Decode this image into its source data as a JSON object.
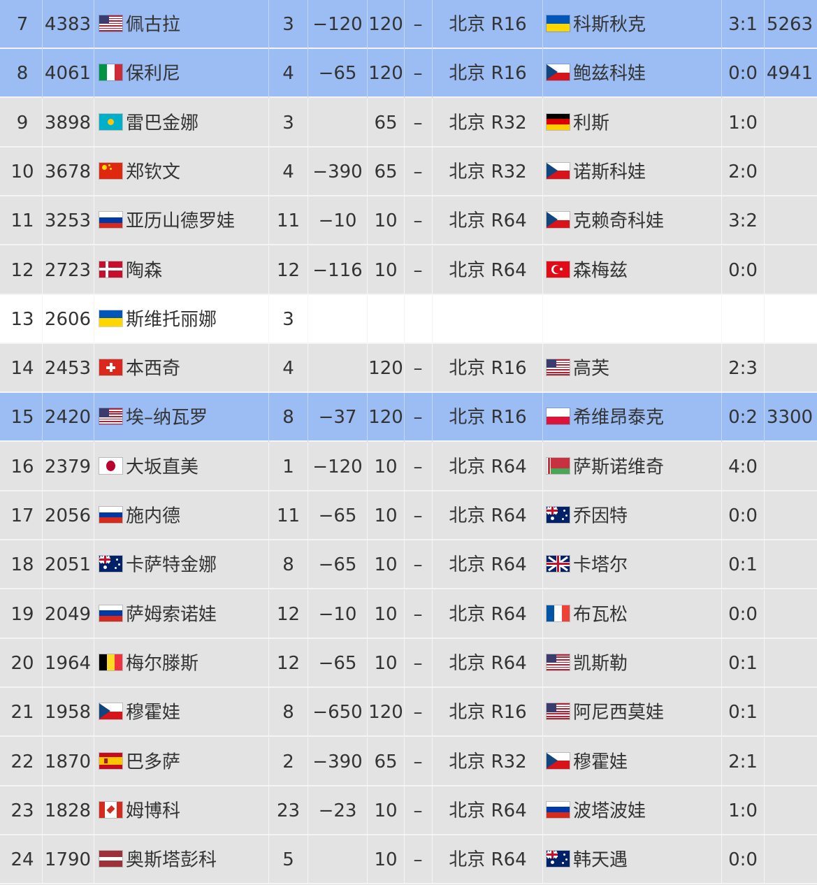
{
  "rows": [
    {
      "rank": "7",
      "points": "4383",
      "flag": "usa-flag-icon",
      "player": "佩古拉",
      "seed": "3",
      "diff": "−120",
      "defend": "120",
      "dash": "–",
      "event": "北京 R16",
      "opp_flag": "ukraine-flag-icon",
      "opponent": "科斯秋克",
      "score": "3:1",
      "projected": "5263",
      "highlight": "blue"
    },
    {
      "rank": "8",
      "points": "4061",
      "flag": "italy-flag-icon",
      "player": "保利尼",
      "seed": "4",
      "diff": "−65",
      "defend": "120",
      "dash": "–",
      "event": "北京 R16",
      "opp_flag": "czech-flag-icon",
      "opponent": "鲍兹科娃",
      "score": "0:0",
      "projected": "4941",
      "highlight": "blue"
    },
    {
      "rank": "9",
      "points": "3898",
      "flag": "kazakhstan-flag-icon",
      "player": "雷巴金娜",
      "seed": "3",
      "diff": "",
      "defend": "65",
      "dash": "–",
      "event": "北京 R32",
      "opp_flag": "germany-flag-icon",
      "opponent": "利斯",
      "score": "1:0",
      "projected": "",
      "highlight": "grey"
    },
    {
      "rank": "10",
      "points": "3678",
      "flag": "china-flag-icon",
      "player": "郑钦文",
      "seed": "4",
      "diff": "−390",
      "defend": "65",
      "dash": "–",
      "event": "北京 R32",
      "opp_flag": "czech-flag-icon",
      "opponent": "诺斯科娃",
      "score": "2:0",
      "projected": "",
      "highlight": "grey"
    },
    {
      "rank": "11",
      "points": "3253",
      "flag": "russia-flag-icon",
      "player": "亚历山德罗娃",
      "seed": "11",
      "diff": "−10",
      "defend": "10",
      "dash": "–",
      "event": "北京 R64",
      "opp_flag": "czech-flag-icon",
      "opponent": "克赖奇科娃",
      "score": "3:2",
      "projected": "",
      "highlight": "grey"
    },
    {
      "rank": "12",
      "points": "2723",
      "flag": "denmark-flag-icon",
      "player": "陶森",
      "seed": "12",
      "diff": "−116",
      "defend": "10",
      "dash": "–",
      "event": "北京 R64",
      "opp_flag": "turkey-flag-icon",
      "opponent": "森梅兹",
      "score": "0:0",
      "projected": "",
      "highlight": "grey"
    },
    {
      "rank": "13",
      "points": "2606",
      "flag": "ukraine-flag-icon",
      "player": "斯维托丽娜",
      "seed": "3",
      "diff": "",
      "defend": "",
      "dash": "",
      "event": "",
      "opp_flag": "",
      "opponent": "",
      "score": "",
      "projected": "",
      "highlight": "white"
    },
    {
      "rank": "14",
      "points": "2453",
      "flag": "switzerland-flag-icon",
      "player": "本西奇",
      "seed": "4",
      "diff": "",
      "defend": "120",
      "dash": "–",
      "event": "北京 R16",
      "opp_flag": "usa-flag-icon",
      "opponent": "高芙",
      "score": "2:3",
      "projected": "",
      "highlight": "grey"
    },
    {
      "rank": "15",
      "points": "2420",
      "flag": "usa-flag-icon",
      "player": "埃–纳瓦罗",
      "seed": "8",
      "diff": "−37",
      "defend": "120",
      "dash": "–",
      "event": "北京 R16",
      "opp_flag": "poland-flag-icon",
      "opponent": "希维昂泰克",
      "score": "0:2",
      "projected": "3300",
      "highlight": "blue"
    },
    {
      "rank": "16",
      "points": "2379",
      "flag": "japan-flag-icon",
      "player": "大坂直美",
      "seed": "1",
      "diff": "−120",
      "defend": "10",
      "dash": "–",
      "event": "北京 R64",
      "opp_flag": "belarus-flag-icon",
      "opponent": "萨斯诺维奇",
      "score": "4:0",
      "projected": "",
      "highlight": "grey"
    },
    {
      "rank": "17",
      "points": "2056",
      "flag": "russia-flag-icon",
      "player": "施内德",
      "seed": "11",
      "diff": "−65",
      "defend": "10",
      "dash": "–",
      "event": "北京 R64",
      "opp_flag": "australia-flag-icon",
      "opponent": "乔因特",
      "score": "0:0",
      "projected": "",
      "highlight": "grey"
    },
    {
      "rank": "18",
      "points": "2051",
      "flag": "australia-flag-icon",
      "player": "卡萨特金娜",
      "seed": "8",
      "diff": "−65",
      "defend": "10",
      "dash": "–",
      "event": "北京 R64",
      "opp_flag": "uk-flag-icon",
      "opponent": "卡塔尔",
      "score": "0:1",
      "projected": "",
      "highlight": "grey"
    },
    {
      "rank": "19",
      "points": "2049",
      "flag": "russia-flag-icon",
      "player": "萨姆索诺娃",
      "seed": "12",
      "diff": "−10",
      "defend": "10",
      "dash": "–",
      "event": "北京 R64",
      "opp_flag": "france-flag-icon",
      "opponent": "布瓦松",
      "score": "0:0",
      "projected": "",
      "highlight": "grey"
    },
    {
      "rank": "20",
      "points": "1964",
      "flag": "belgium-flag-icon",
      "player": "梅尔滕斯",
      "seed": "12",
      "diff": "−65",
      "defend": "10",
      "dash": "–",
      "event": "北京 R64",
      "opp_flag": "usa-flag-icon",
      "opponent": "凯斯勒",
      "score": "0:1",
      "projected": "",
      "highlight": "grey"
    },
    {
      "rank": "21",
      "points": "1958",
      "flag": "czech-flag-icon",
      "player": "穆霍娃",
      "seed": "8",
      "diff": "−650",
      "defend": "120",
      "dash": "–",
      "event": "北京 R16",
      "opp_flag": "usa-flag-icon",
      "opponent": "阿尼西莫娃",
      "score": "0:1",
      "projected": "",
      "highlight": "grey"
    },
    {
      "rank": "22",
      "points": "1870",
      "flag": "spain-flag-icon",
      "player": "巴多萨",
      "seed": "2",
      "diff": "−390",
      "defend": "65",
      "dash": "–",
      "event": "北京 R32",
      "opp_flag": "czech-flag-icon",
      "opponent": "穆霍娃",
      "score": "2:1",
      "projected": "",
      "highlight": "grey"
    },
    {
      "rank": "23",
      "points": "1828",
      "flag": "canada-flag-icon",
      "player": "姆博科",
      "seed": "23",
      "diff": "−23",
      "defend": "10",
      "dash": "–",
      "event": "北京 R64",
      "opp_flag": "russia-flag-icon",
      "opponent": "波塔波娃",
      "score": "1:0",
      "projected": "",
      "highlight": "grey"
    },
    {
      "rank": "24",
      "points": "1790",
      "flag": "latvia-flag-icon",
      "player": "奥斯塔彭科",
      "seed": "5",
      "diff": "",
      "defend": "10",
      "dash": "–",
      "event": "北京 R64",
      "opp_flag": "australia-flag-icon",
      "opponent": "韩天遇",
      "score": "0:0",
      "projected": "",
      "highlight": "grey"
    }
  ]
}
